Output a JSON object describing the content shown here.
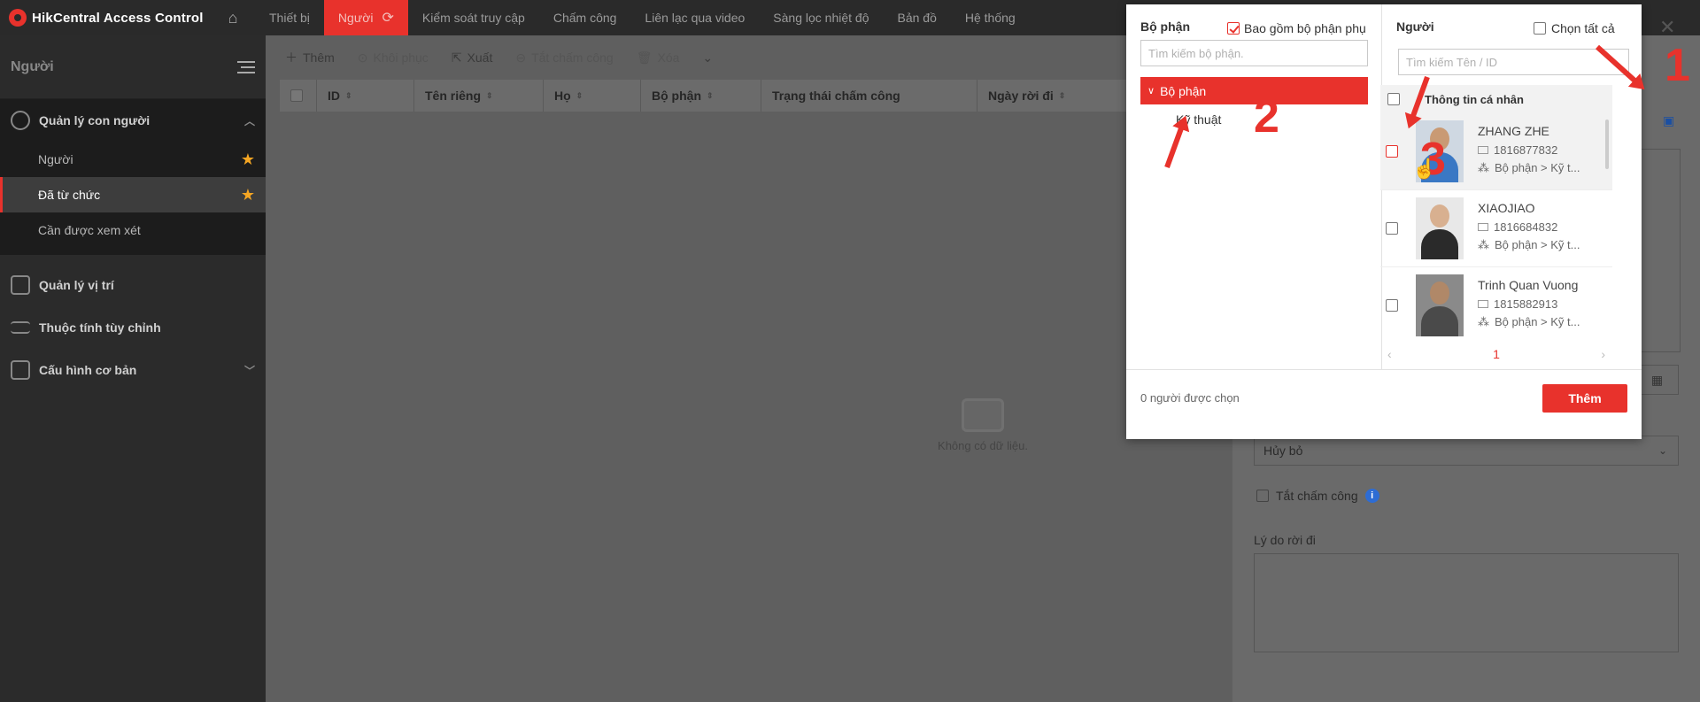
{
  "app": {
    "title": "HikCentral Access Control"
  },
  "nav": [
    {
      "label": "Thiết bị"
    },
    {
      "label": "Người"
    },
    {
      "label": "Kiểm soát truy cập"
    },
    {
      "label": "Chấm công"
    },
    {
      "label": "Liên lạc qua video"
    },
    {
      "label": "Sàng lọc nhiệt độ"
    },
    {
      "label": "Bản đồ"
    },
    {
      "label": "Hệ thống"
    }
  ],
  "sidebar": {
    "title": "Người",
    "group1": "Quản lý con người",
    "items": [
      {
        "label": "Người"
      },
      {
        "label": "Đã từ chức"
      },
      {
        "label": "Cần được xem xét"
      }
    ],
    "group2": "Quản lý vị trí",
    "group3": "Thuộc tính tùy chỉnh",
    "group4": "Cấu hình cơ bản"
  },
  "toolbar": {
    "add": "Thêm",
    "restore": "Khôi phục",
    "export": "Xuất",
    "attendance_off": "Tắt chấm công",
    "delete": "Xóa"
  },
  "table": {
    "columns": [
      "ID",
      "Tên riêng",
      "Họ",
      "Bộ phận",
      "Trạng thái chấm công",
      "Ngày rời đi"
    ],
    "empty": "Không có dữ liệu."
  },
  "right_panel": {
    "select_value": "Hủy bỏ",
    "attendance_off": "Tắt chấm công",
    "reason_label": "Lý do rời đi"
  },
  "modal": {
    "dept_title": "Bộ phận",
    "include_sub": "Bao gồm bộ phận phụ",
    "dept_search_placeholder": "Tìm kiếm bộ phận.",
    "dept_root": "Bộ phận",
    "dept_child": "Kỹ thuật",
    "people_title": "Người",
    "select_all": "Chọn tất cả",
    "people_search_placeholder": "Tìm kiếm Tên / ID",
    "personal_info": "Thông tin cá nhân",
    "people": [
      {
        "name": "ZHANG ZHE",
        "id": "1816877832",
        "dept": "Bộ phận > Kỹ t..."
      },
      {
        "name": "XIAOJIAO",
        "id": "1816684832",
        "dept": "Bộ phận > Kỹ t..."
      },
      {
        "name": "Trinh Quan Vuong",
        "id": "1815882913",
        "dept": "Bộ phận > Kỹ t..."
      }
    ],
    "page": "1",
    "selected_count": "0 người được chọn",
    "add_button": "Thêm"
  },
  "annotations": {
    "a1": "1",
    "a2": "2",
    "a3": "3"
  },
  "colors": {
    "accent": "#e8322c",
    "topbar": "#2a2a2a",
    "sidebar": "#2b2b2b"
  }
}
